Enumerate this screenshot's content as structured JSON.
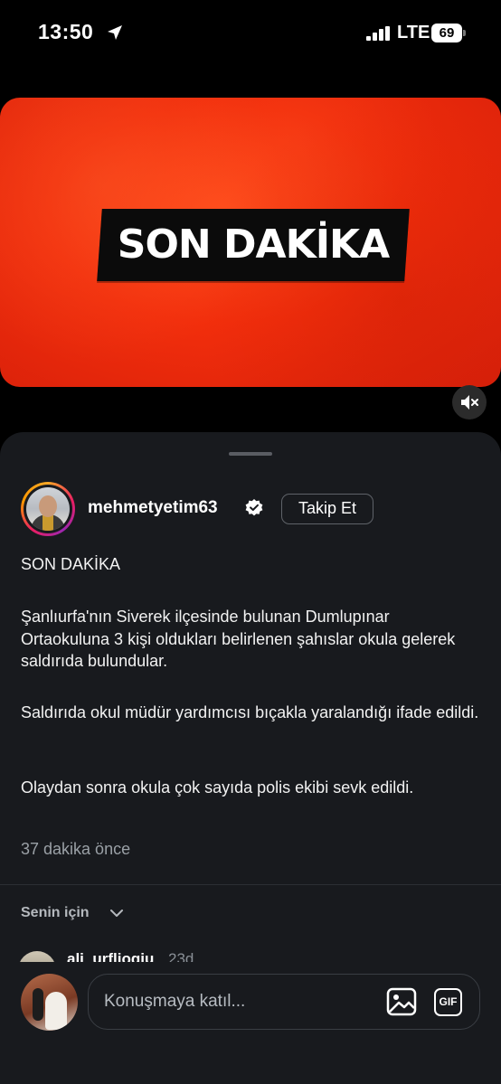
{
  "status_bar": {
    "time": "13:50",
    "network": "LTE",
    "battery": "69",
    "icons": [
      "location-arrow-icon",
      "signal-bars-icon",
      "battery-icon"
    ]
  },
  "media": {
    "banner_text": "SON DAKİKA",
    "background_color": "#f22e0c",
    "mute_icon": "speaker-muted-icon"
  },
  "post": {
    "username": "mehmetyetim63",
    "verified_icon": "verified-badge-icon",
    "follow_label": "Takip Et",
    "title": "SON DAKİKA",
    "paragraphs": [
      "Şanlıurfa'nın Siverek ilçesinde bulunan Dumlupınar Ortaokuluna 3 kişi oldukları belirlenen şahıslar okula gelerek saldırıda bulundular.",
      "Saldırıda okul müdür yardımcısı bıçakla yaralandığı ifade edildi.",
      "Olaydan sonra okula çok sayıda polis ekibi sevk edildi."
    ],
    "time_ago": "37 dakika önce"
  },
  "comments": {
    "filter_label": "Senin için",
    "first_comment": {
      "username": "ali_urfliogju",
      "time": "23d"
    }
  },
  "composer": {
    "placeholder": "Konuşmaya katıl...",
    "image_icon": "image-icon",
    "gif_label": "GIF"
  },
  "colors": {
    "sheet_background": "#181a1e",
    "accent_red": "#f22e0c"
  }
}
